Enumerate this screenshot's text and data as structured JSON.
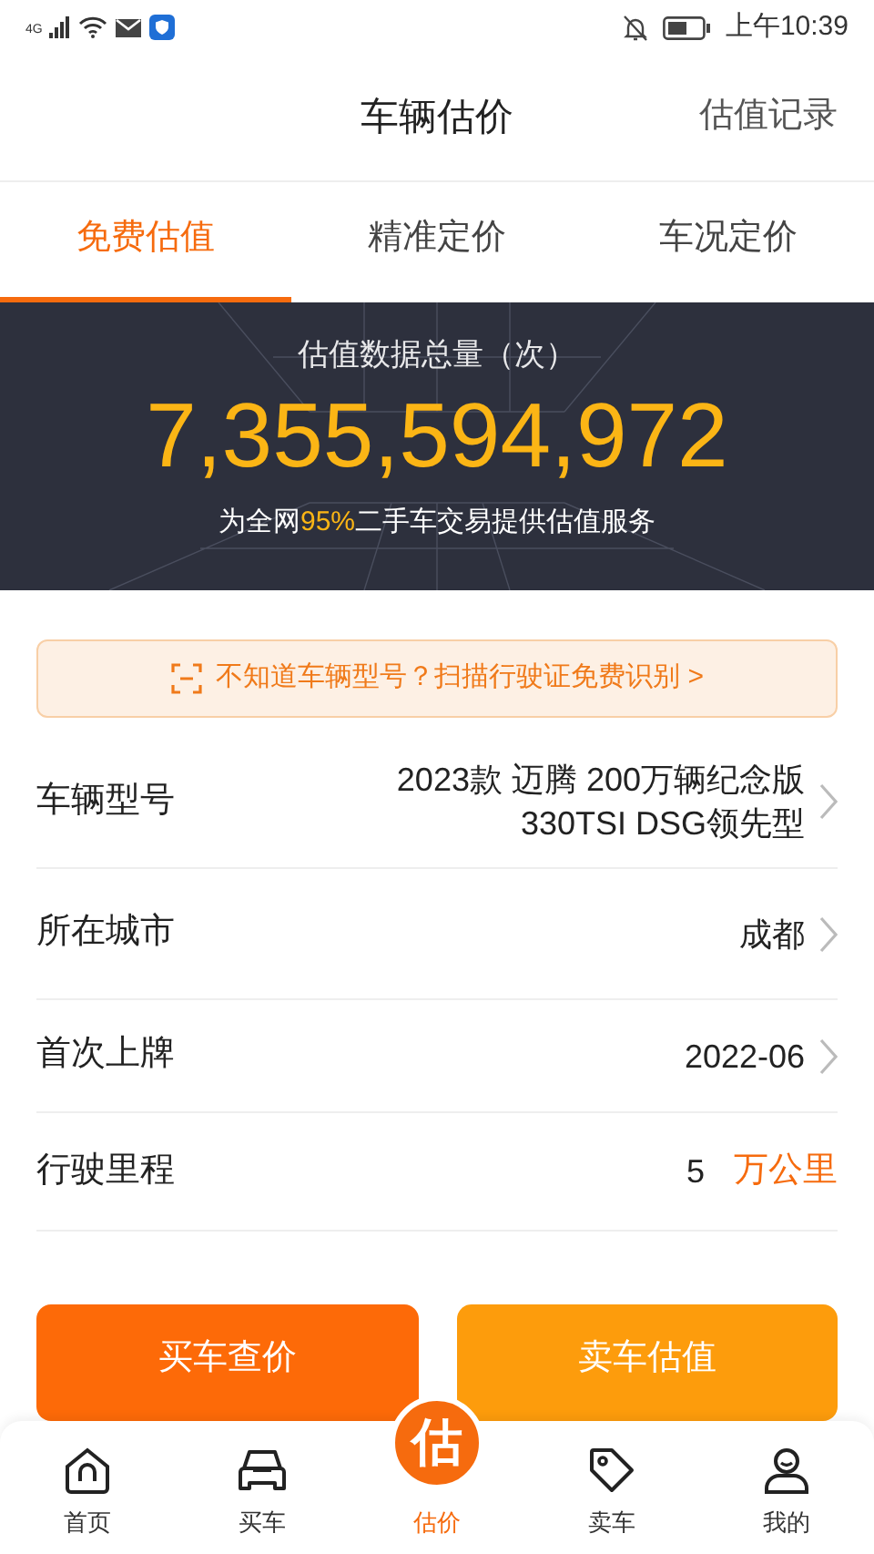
{
  "status_bar": {
    "network": "4G",
    "time": "上午10:39"
  },
  "header": {
    "title": "车辆估价",
    "action": "估值记录"
  },
  "tabs": [
    {
      "label": "免费估值",
      "selected": true
    },
    {
      "label": "精准定价",
      "selected": false
    },
    {
      "label": "车况定价",
      "selected": false
    }
  ],
  "banner": {
    "caption": "估值数据总量（次）",
    "count": "7,355,594,972",
    "note_before": "为全网",
    "note_highlight": "95%",
    "note_after": "二手车交易提供估值服务"
  },
  "scan_tip": "不知道车辆型号？扫描行驶证免费识别 >",
  "fields": [
    {
      "label": "车辆型号",
      "value_lines": [
        "2023款 迈腾 200万辆纪念版",
        "330TSI DSG领先型"
      ],
      "chevron": true
    },
    {
      "label": "所在城市",
      "value_lines": [
        "成都"
      ],
      "chevron": true
    },
    {
      "label": "首次上牌",
      "value_lines": [
        "2022-06"
      ],
      "chevron": true
    },
    {
      "label": "行驶里程",
      "value_lines": [
        "5"
      ],
      "unit": "万公里",
      "chevron": false
    }
  ],
  "buttons": [
    {
      "label": "买车查价",
      "kind": "primary"
    },
    {
      "label": "卖车估值",
      "kind": "secondary"
    }
  ],
  "nav": [
    {
      "label": "首页",
      "kind": "home",
      "selected": false
    },
    {
      "label": "买车",
      "kind": "car",
      "selected": false
    },
    {
      "label": "估价",
      "kind": "badge",
      "badge_text": "估",
      "selected": true
    },
    {
      "label": "卖车",
      "kind": "tag",
      "selected": false
    },
    {
      "label": "我的",
      "kind": "user",
      "selected": false
    }
  ]
}
